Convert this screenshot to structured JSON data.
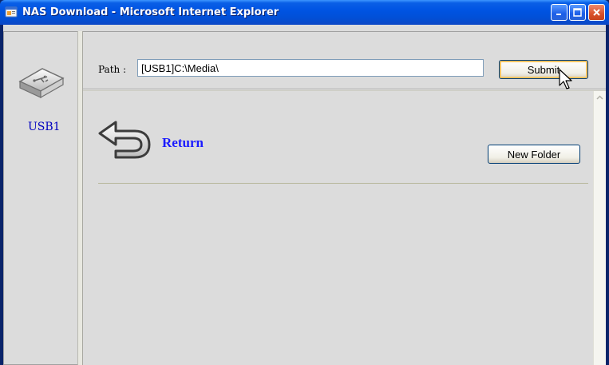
{
  "window": {
    "title": "NAS Download - Microsoft Internet Explorer"
  },
  "sidebar": {
    "device_label": "USB1",
    "device_icon": "usb-drive-icon"
  },
  "path_bar": {
    "label": "Path :",
    "value": "[USB1]C:\\Media\\",
    "submit_label": "Submit"
  },
  "content": {
    "return_label": "Return",
    "return_icon": "return-arrow-icon",
    "new_folder_label": "New Folder"
  },
  "colors": {
    "titlebar": "#0054e3",
    "link": "#1a1aff",
    "device_label": "#0000c0",
    "panel_bg": "#dcdcdc"
  }
}
